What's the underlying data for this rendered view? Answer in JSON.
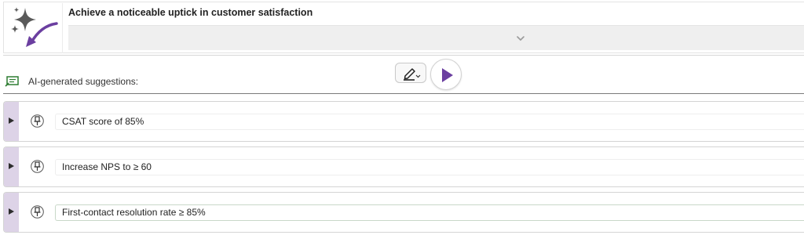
{
  "objective": {
    "title": "Achieve a noticeable uptick in customer satisfaction",
    "logo_icon": "sparkle-arrow-icon",
    "expand_icon": "chevron-down-icon"
  },
  "toolbar": {
    "edit_icon": "pen-icon",
    "run_icon": "play-icon"
  },
  "ai_section": {
    "icon": "ai-suggestion-icon",
    "label": "AI-generated suggestions:"
  },
  "suggestions": [
    {
      "text": "CSAT score of 85%",
      "pin_icon": "pin-icon",
      "expand_icon": "triangle-right-icon"
    },
    {
      "text": "Increase NPS to ≥ 60",
      "pin_icon": "pin-icon",
      "expand_icon": "triangle-right-icon"
    },
    {
      "text": "First-contact resolution rate ≥ 85%",
      "pin_icon": "pin-icon",
      "expand_icon": "triangle-right-icon"
    }
  ],
  "colors": {
    "accent_purple": "#6b3fa0",
    "grip_purple": "#ddd3e7",
    "logo_gray": "#555555"
  }
}
